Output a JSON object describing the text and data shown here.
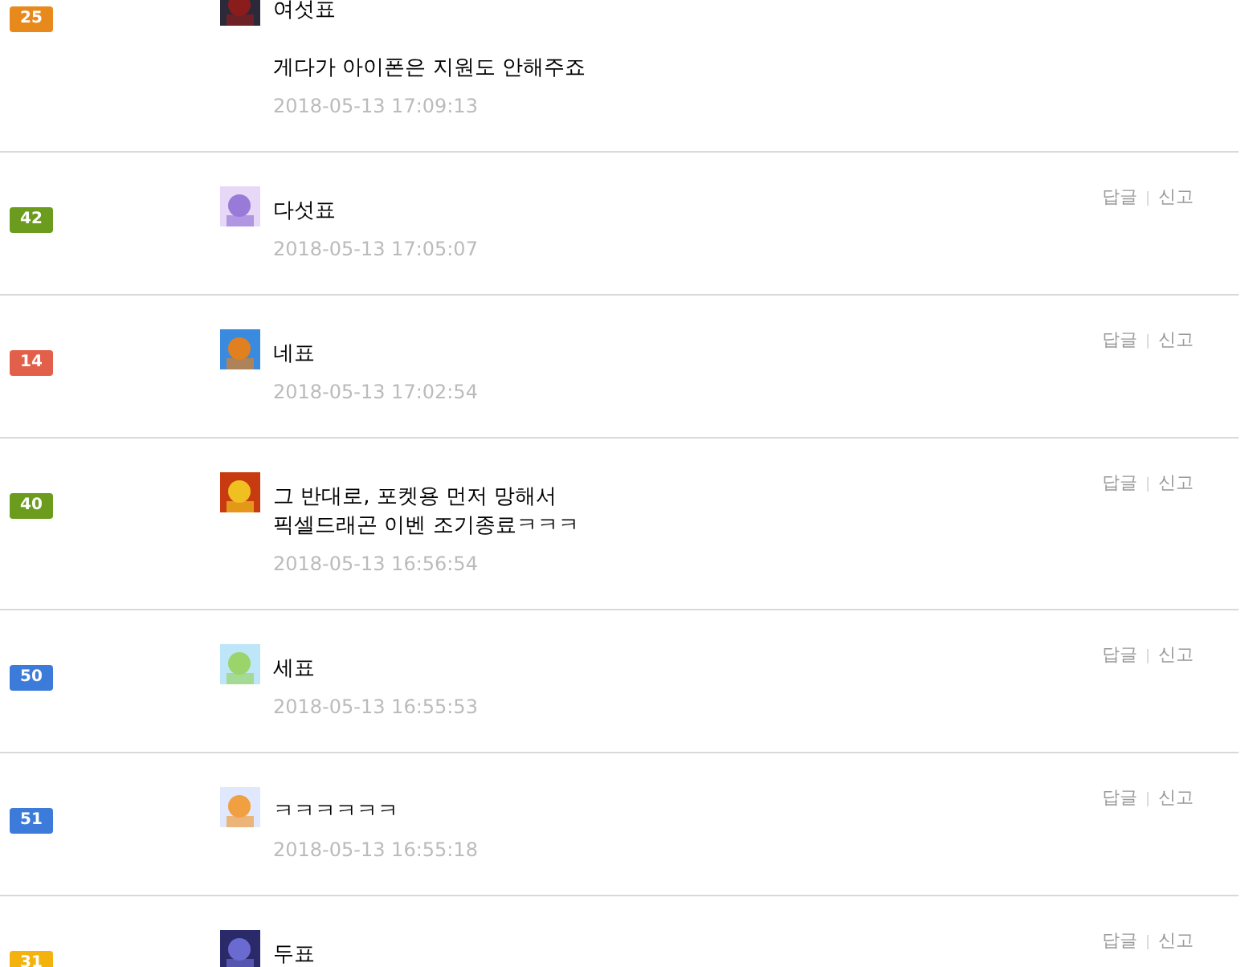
{
  "comments": [
    {
      "level": "25",
      "color": "#e8891c",
      "text": "여섯표\n\n게다가 아이폰은 지원도 안해주죠",
      "date": "2018-05-13 17:09:13"
    },
    {
      "level": "42",
      "color": "#6b9c1e",
      "text": "다섯표",
      "date": "2018-05-13 17:05:07",
      "actions": [
        "답글",
        "신고"
      ]
    },
    {
      "level": "14",
      "color": "#e2604a",
      "text": "네표",
      "date": "2018-05-13 17:02:54",
      "actions": [
        "답글",
        "신고"
      ]
    },
    {
      "level": "40",
      "color": "#6b9c1e",
      "text": "그 반대로, 포켓용 먼저 망해서\n픽셀드래곤 이벤 조기종료ㅋㅋㅋ",
      "date": "2018-05-13 16:56:54",
      "actions": [
        "답글",
        "신고"
      ]
    },
    {
      "level": "50",
      "color": "#3c7bd9",
      "text": "세표",
      "date": "2018-05-13 16:55:53",
      "actions": [
        "답글",
        "신고"
      ]
    },
    {
      "level": "51",
      "color": "#3c7bd9",
      "text": "ㅋㅋㅋㅋㅋㅋ",
      "date": "2018-05-13 16:55:18",
      "actions": [
        "답글",
        "신고"
      ]
    },
    {
      "level": "31",
      "color": "#f3b20e",
      "text": "두표",
      "actions": [
        "답글",
        "신고"
      ]
    }
  ]
}
